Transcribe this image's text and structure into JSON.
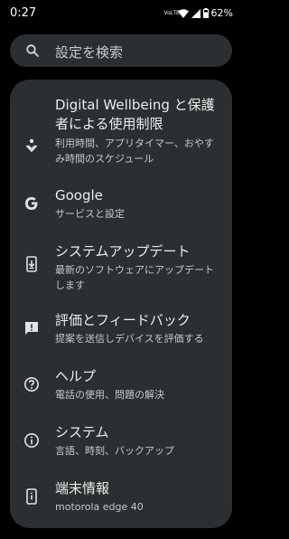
{
  "status": {
    "time": "0:27",
    "volte_top": "VoLTE",
    "battery": "62%"
  },
  "search": {
    "placeholder": "設定を検索"
  },
  "items": [
    {
      "icon": "digital-wellbeing-icon",
      "title": "Digital Wellbeing と保護者による使用制限",
      "subtitle": "利用時間、アプリタイマー、おやすみ時間のスケジュール"
    },
    {
      "icon": "google-icon",
      "title": "Google",
      "subtitle": "サービスと設定"
    },
    {
      "icon": "system-update-icon",
      "title": "システムアップデート",
      "subtitle": "最新のソフトウェアにアップデートします"
    },
    {
      "icon": "feedback-icon",
      "title": "評価とフィードバック",
      "subtitle": "提案を送信しデバイスを評価する"
    },
    {
      "icon": "help-icon",
      "title": "ヘルプ",
      "subtitle": "電話の使用、問題の解決"
    },
    {
      "icon": "info-icon",
      "title": "システム",
      "subtitle": "言語、時刻、バックアップ"
    },
    {
      "icon": "phone-info-icon",
      "title": "端末情報",
      "subtitle": "motorola edge 40"
    }
  ]
}
